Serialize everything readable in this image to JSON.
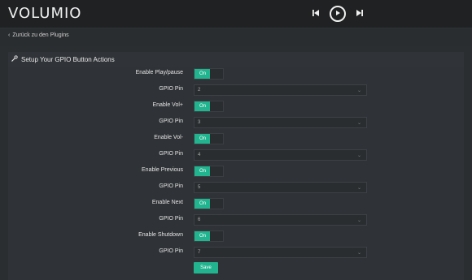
{
  "header": {
    "logo_text": "VOLUMIO",
    "icons": {
      "prev": "skip-previous-icon",
      "play": "play-icon",
      "next": "skip-next-icon"
    }
  },
  "nav": {
    "back_label": "Zurück zu den Plugins"
  },
  "section": {
    "title": "Setup Your GPIO Button Actions"
  },
  "rows": [
    {
      "type": "toggle",
      "label": "Enable Play/pause",
      "state": "On"
    },
    {
      "type": "select",
      "label": "GPIO Pin",
      "value": "2"
    },
    {
      "type": "toggle",
      "label": "Enable Vol+",
      "state": "On"
    },
    {
      "type": "select",
      "label": "GPIO Pin",
      "value": "3"
    },
    {
      "type": "toggle",
      "label": "Enable Vol-",
      "state": "On"
    },
    {
      "type": "select",
      "label": "GPIO Pin",
      "value": "4"
    },
    {
      "type": "toggle",
      "label": "Enable Previous",
      "state": "On"
    },
    {
      "type": "select",
      "label": "GPIO Pin",
      "value": "5"
    },
    {
      "type": "toggle",
      "label": "Enable Next",
      "state": "On"
    },
    {
      "type": "select",
      "label": "GPIO Pin",
      "value": "6"
    },
    {
      "type": "toggle",
      "label": "Enable Shutdown",
      "state": "On"
    },
    {
      "type": "select",
      "label": "GPIO Pin",
      "value": "7"
    }
  ],
  "actions": {
    "save_label": "Save"
  },
  "colors": {
    "accent": "#21b48e",
    "background": "#2b2e31",
    "header": "#1f2123"
  }
}
